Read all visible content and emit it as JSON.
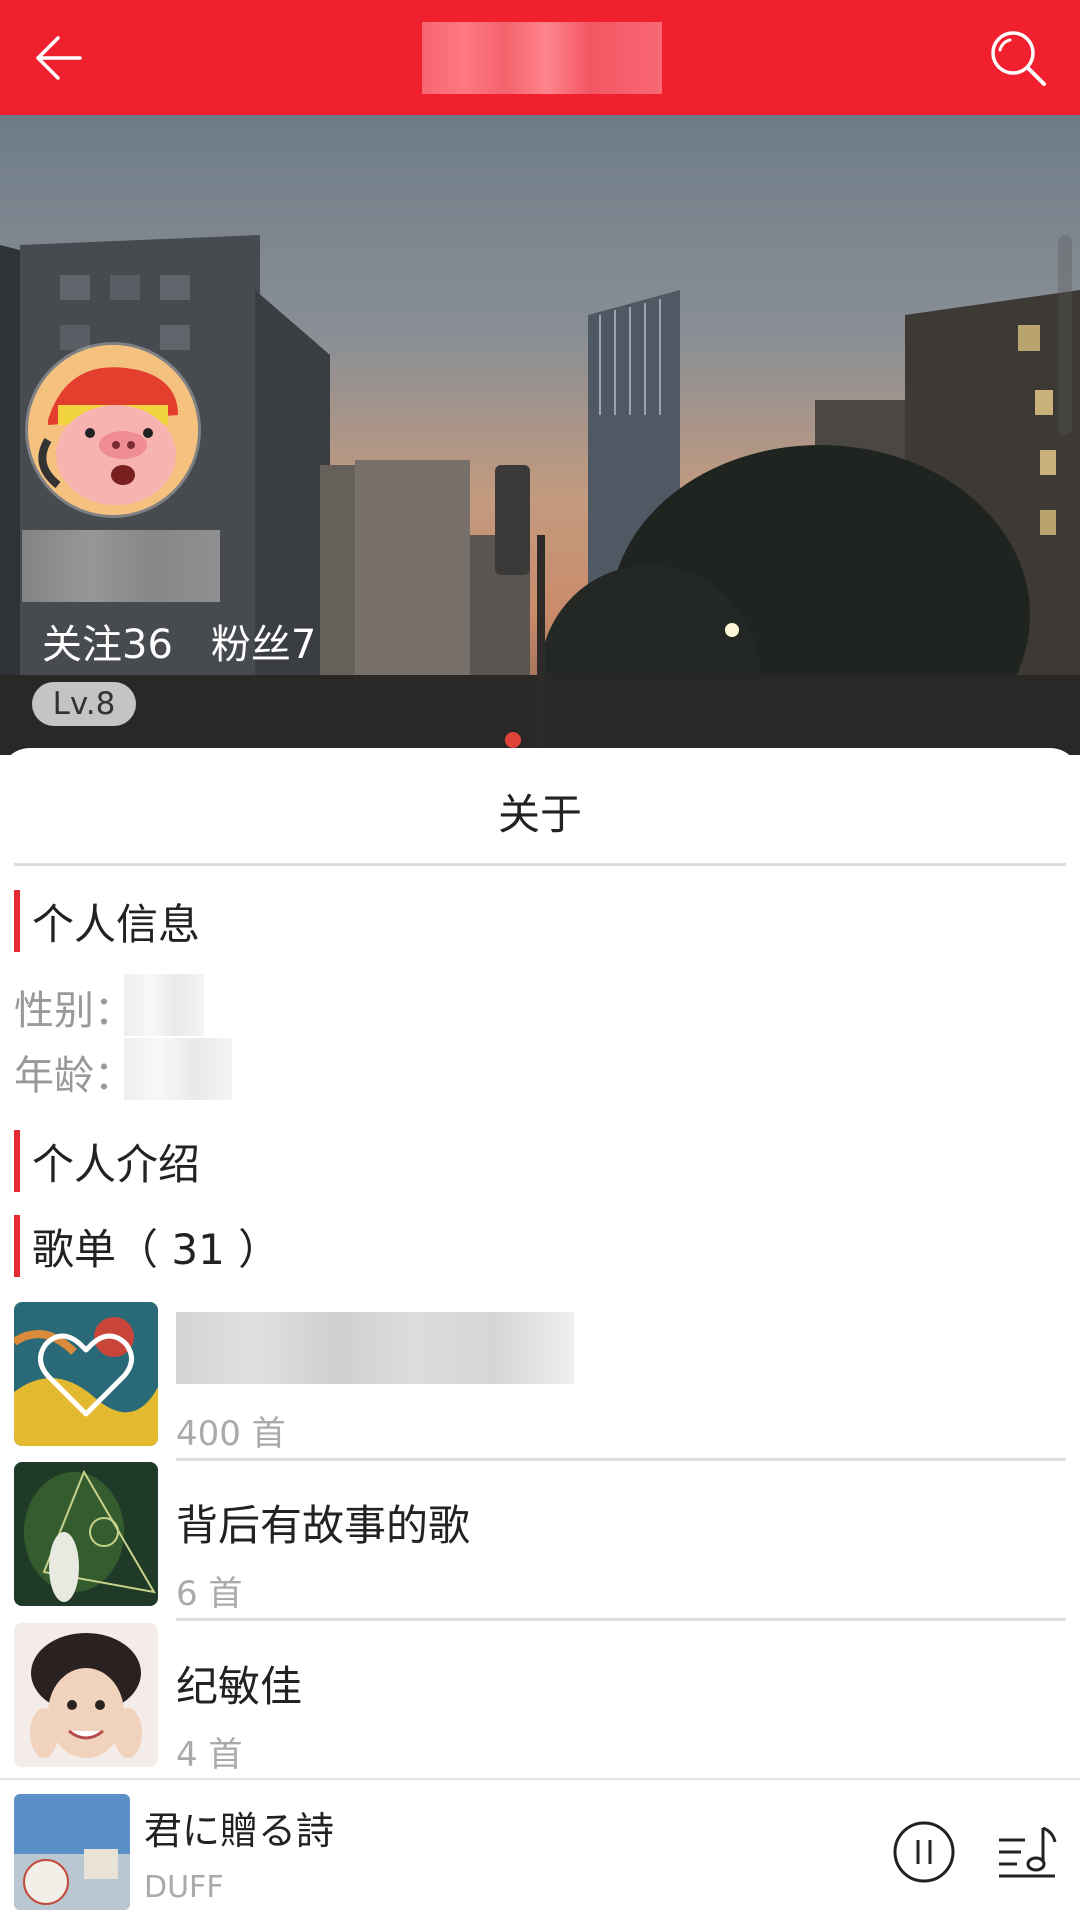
{
  "header": {
    "title": ""
  },
  "profile": {
    "stats": {
      "follow": "关注36",
      "fans": "粉丝7"
    },
    "level": "Lv.8"
  },
  "about": {
    "tab_label": "关于",
    "personal_info": {
      "heading": "个人信息",
      "gender_label": "性别：",
      "age_label": "年龄："
    },
    "introduction_heading": "个人介绍",
    "playlists": {
      "heading": "歌单（ 31 ）",
      "items": [
        {
          "title": "",
          "count": "400 首",
          "cover_icon": "heart-icon"
        },
        {
          "title": "背后有故事的歌",
          "count": "6 首"
        },
        {
          "title": "纪敏佳",
          "count": "4 首"
        }
      ]
    }
  },
  "player": {
    "song": "君に贈る詩",
    "artist": "DUFF"
  },
  "colors": {
    "brand": "#f0202e",
    "accent_bar": "#e62a32"
  },
  "icons": [
    "back-arrow-icon",
    "search-icon",
    "heart-icon",
    "pause-icon",
    "playlist-queue-icon"
  ]
}
